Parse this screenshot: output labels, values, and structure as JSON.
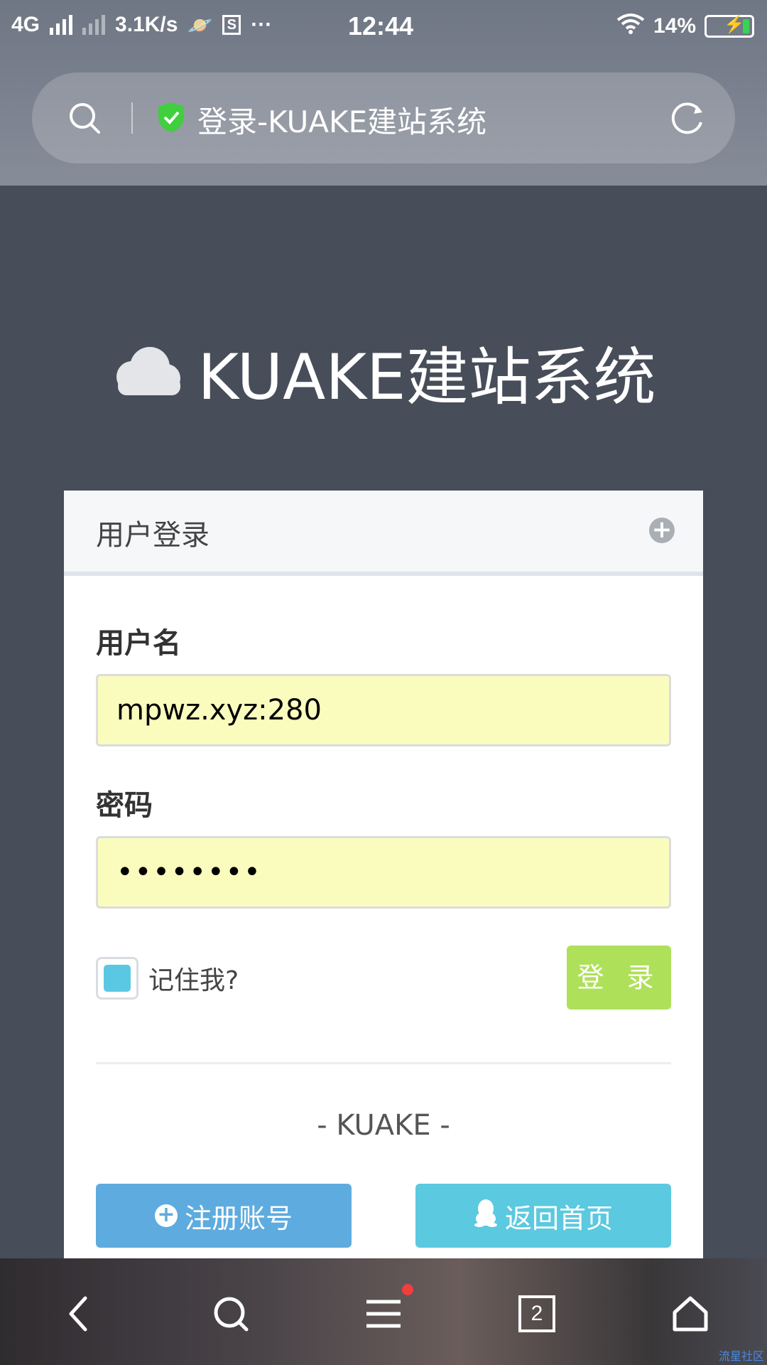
{
  "status_bar": {
    "network": "4G",
    "speed": "3.1K/s",
    "time": "12:44",
    "battery": "14%"
  },
  "browser": {
    "page_title": "登录-KUAKE建站系统",
    "open_tabs": "2"
  },
  "hero": {
    "site_title": "KUAKE建站系统"
  },
  "login_card": {
    "header": "用户登录",
    "username_label": "用户名",
    "username_value": "mpwz.xyz:280",
    "password_label": "密码",
    "password_value": "••••••••",
    "remember_label": "记住我?",
    "login_button": "登 录",
    "brand": "- KUAKE -",
    "register_button": "注册账号",
    "home_button": "返回首页"
  },
  "watermark": "流星社区",
  "colors": {
    "page_bg": "#474d59",
    "input_bg": "#fafcbe",
    "login_btn": "#aee05a",
    "register_btn": "#5eabdf",
    "home_btn": "#5bc9df"
  }
}
